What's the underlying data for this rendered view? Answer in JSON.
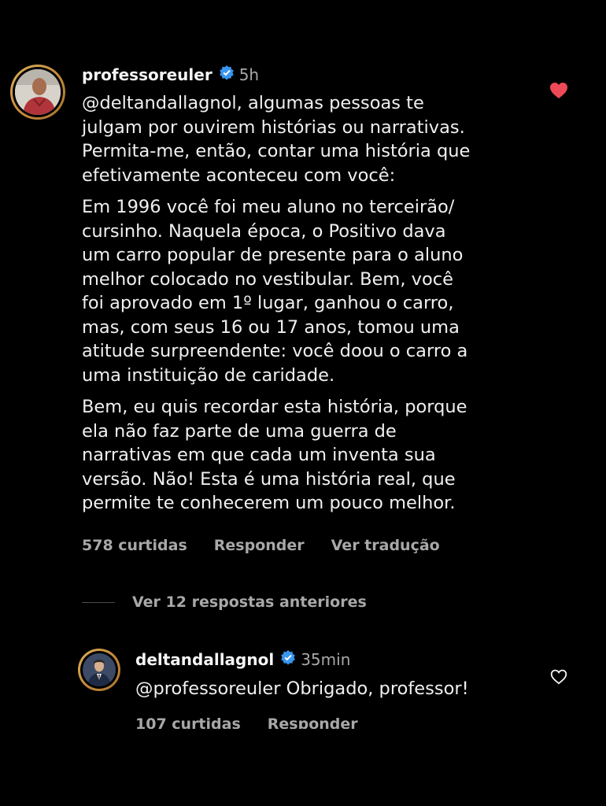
{
  "comment": {
    "username": "professoreuler",
    "time": "5h",
    "paragraphs": [
      "@deltandallagnol, algumas pessoas te\njulgam por ouvirem histórias ou narrativas.\nPermita-me, então, contar uma história que\nefetivamente aconteceu com você:",
      "Em 1996 você foi meu aluno no terceirão/\ncursinho. Naquela época, o Positivo dava\num carro popular de presente para o aluno\nmelhor colocado no vestibular. Bem, você\nfoi aprovado em 1º lugar, ganhou o carro,\nmas, com seus 16 ou 17 anos, tomou uma\natitude surpreendente: você doou o carro a\numa instituição de caridade.",
      "Bem, eu quis recordar esta história, porque\nela não faz parte de uma guerra de\nnarrativas em que cada um inventa sua\nversão. Não! Esta é uma história real, que\npermite te conhecerem um pouco melhor."
    ],
    "likes": "578 curtidas",
    "reply_label": "Responder",
    "translate_label": "Ver tradução",
    "liked": true
  },
  "replies_toggle": {
    "label": "Ver 12 respostas anteriores"
  },
  "reply": {
    "username": "deltandallagnol",
    "time": "35min",
    "text": "@professoreuler Obrigado, professor!",
    "likes": "107 curtidas",
    "reply_label": "Responder",
    "liked": false
  },
  "colors": {
    "background": "#000000",
    "text": "#f5f5f5",
    "muted": "#a8a8a8",
    "verified": "#3897f0",
    "like": "#ed4956"
  },
  "icons": [
    "verified-badge-icon",
    "heart-filled-icon",
    "heart-outline-icon"
  ]
}
